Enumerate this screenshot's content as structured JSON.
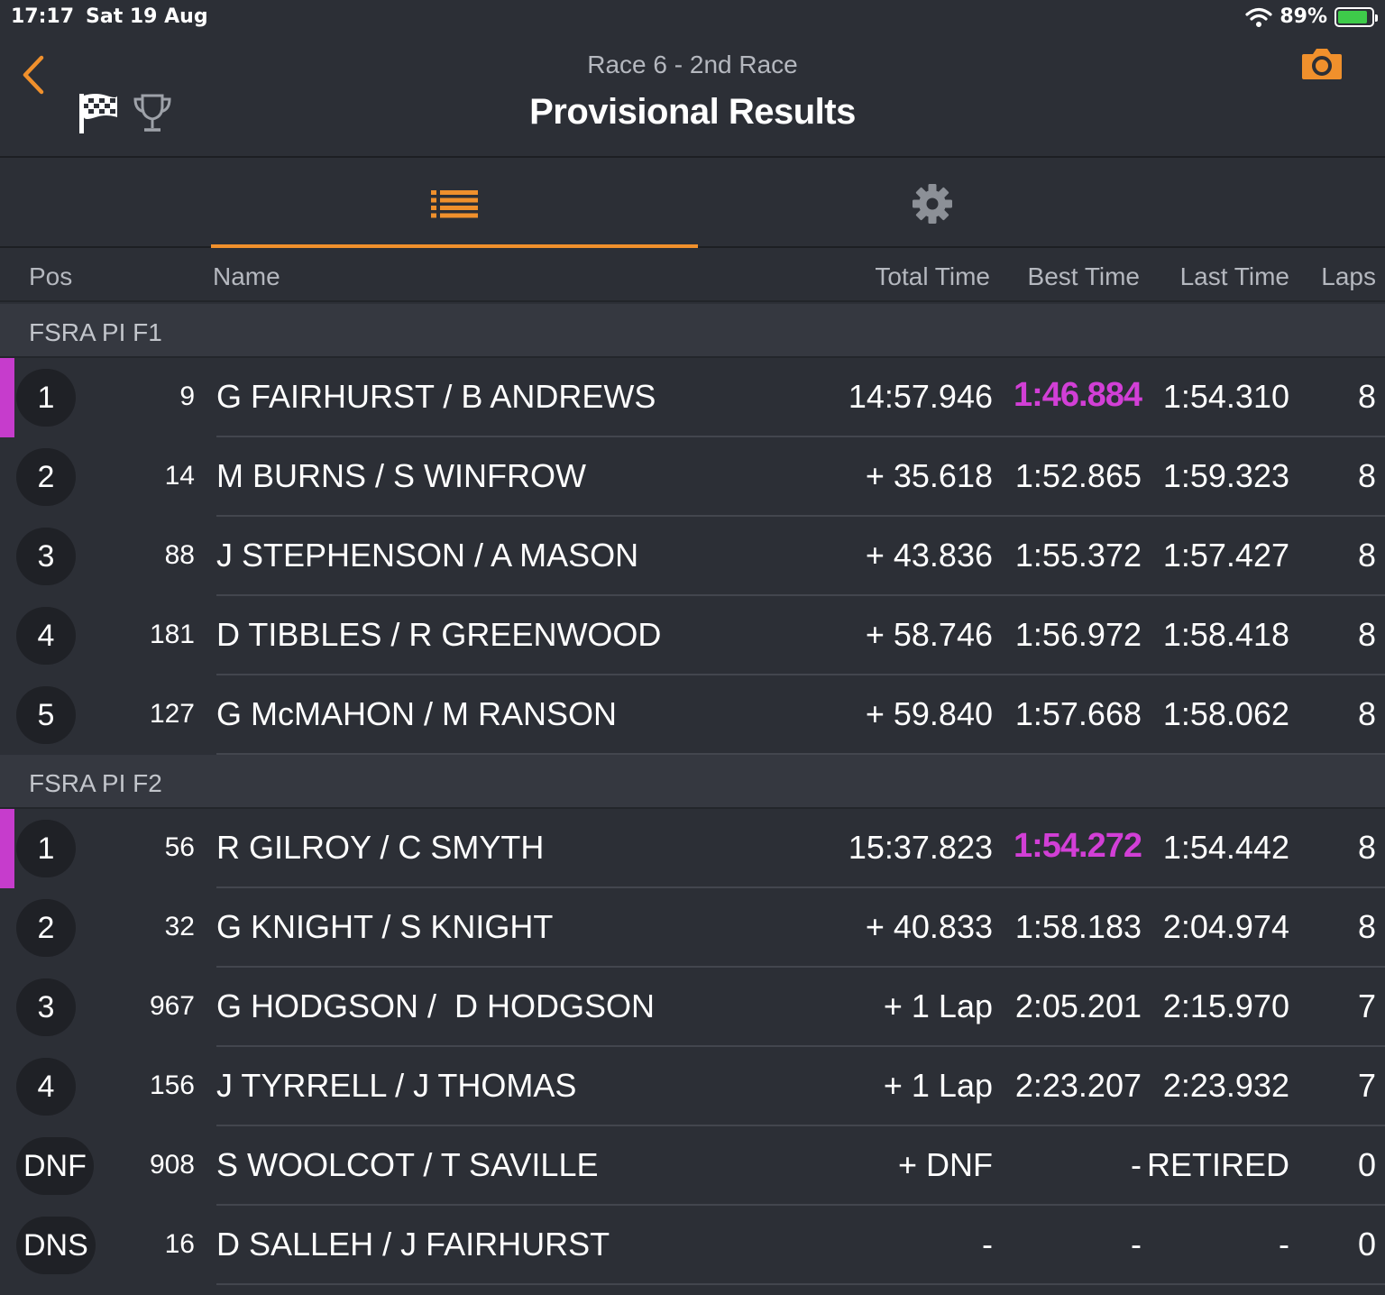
{
  "status_bar": {
    "time": "17:17",
    "date": "Sat 19 Aug",
    "battery": "89%"
  },
  "header": {
    "subtitle": "Race 6 - 2nd Race",
    "title": "Provisional Results"
  },
  "columns": {
    "pos": "Pos",
    "name": "Name",
    "total": "Total Time",
    "best": "Best Time",
    "last": "Last Time",
    "laps": "Laps"
  },
  "colors": {
    "accent": "#f0902c",
    "fastest": "#d23fd6",
    "background": "#2c2f36"
  },
  "groups": [
    {
      "label": "FSRA PI F1",
      "rows": [
        {
          "pos": "1",
          "num": "9",
          "name": "G FAIRHURST / B ANDREWS",
          "total": "14:57.946",
          "best": "1:46.884",
          "last": "1:54.310",
          "laps": "8"
        },
        {
          "pos": "2",
          "num": "14",
          "name": "M BURNS / S WINFROW",
          "total": "+ 35.618",
          "best": "1:52.865",
          "last": "1:59.323",
          "laps": "8"
        },
        {
          "pos": "3",
          "num": "88",
          "name": "J STEPHENSON / A MASON",
          "total": "+ 43.836",
          "best": "1:55.372",
          "last": "1:57.427",
          "laps": "8"
        },
        {
          "pos": "4",
          "num": "181",
          "name": "D TIBBLES / R GREENWOOD",
          "total": "+ 58.746",
          "best": "1:56.972",
          "last": "1:58.418",
          "laps": "8"
        },
        {
          "pos": "5",
          "num": "127",
          "name": "G McMAHON / M RANSON",
          "total": "+ 59.840",
          "best": "1:57.668",
          "last": "1:58.062",
          "laps": "8"
        }
      ]
    },
    {
      "label": "FSRA PI F2",
      "rows": [
        {
          "pos": "1",
          "num": "56",
          "name": "R GILROY / C SMYTH",
          "total": "15:37.823",
          "best": "1:54.272",
          "last": "1:54.442",
          "laps": "8"
        },
        {
          "pos": "2",
          "num": "32",
          "name": "G KNIGHT / S KNIGHT",
          "total": "+ 40.833",
          "best": "1:58.183",
          "last": "2:04.974",
          "laps": "8"
        },
        {
          "pos": "3",
          "num": "967",
          "name": "G HODGSON /  D HODGSON",
          "total": "+ 1 Lap",
          "best": "2:05.201",
          "last": "2:15.970",
          "laps": "7"
        },
        {
          "pos": "4",
          "num": "156",
          "name": "J TYRRELL / J THOMAS",
          "total": "+ 1 Lap",
          "best": "2:23.207",
          "last": "2:23.932",
          "laps": "7"
        },
        {
          "pos": "DNF",
          "num": "908",
          "name": "S WOOLCOT / T SAVILLE",
          "total": "+ DNF",
          "best": "-",
          "last": "RETIRED",
          "laps": "0"
        },
        {
          "pos": "DNS",
          "num": "16",
          "name": "D SALLEH / J FAIRHURST",
          "total": "-",
          "best": "-",
          "last": "-",
          "laps": "0"
        }
      ]
    }
  ]
}
